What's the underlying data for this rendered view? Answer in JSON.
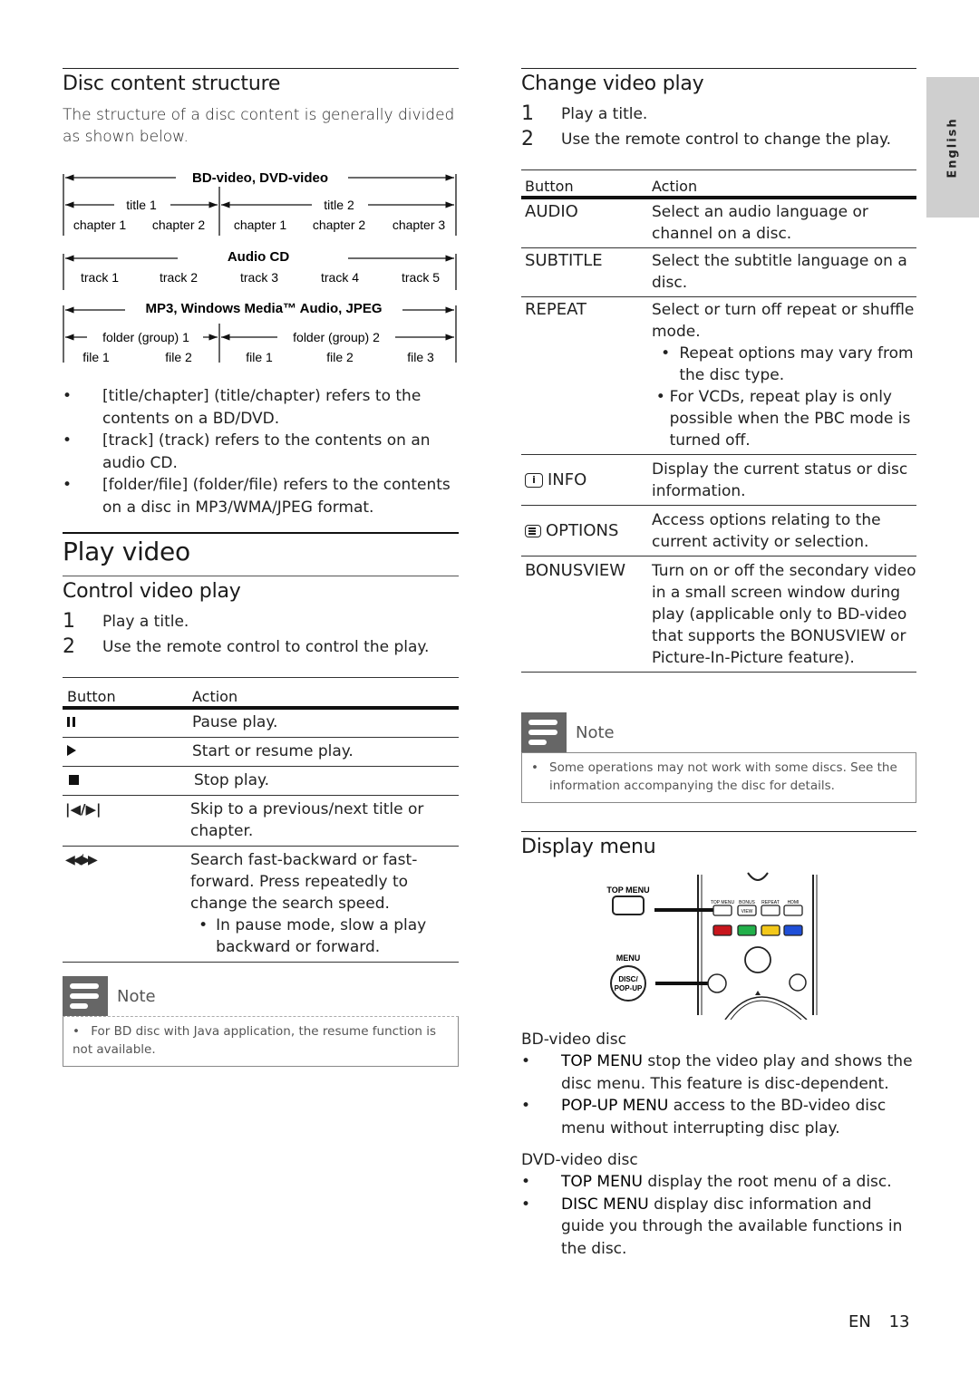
{
  "side_tab": {
    "label": "English",
    "color": "#cfcfcf"
  },
  "left": {
    "disc_structure": {
      "title": "Disc content structure",
      "intro": "The structure of a disc content is generally divided as shown below.",
      "diagram": {
        "bd": {
          "header": "BD-video, DVD-video",
          "title1": "title 1",
          "title2": "title 2",
          "chapters": [
            "chapter 1",
            "chapter 2",
            "chapter 1",
            "chapter 2",
            "chapter 3"
          ]
        },
        "cd": {
          "header": "Audio CD",
          "tracks": [
            "track 1",
            "track 2",
            "track 3",
            "track 4",
            "track 5"
          ]
        },
        "mp3": {
          "header": "MP3, Windows Media™ Audio, JPEG",
          "folder1": "folder (group) 1",
          "folder2": "folder (group) 2",
          "files": [
            "file 1",
            "file 2",
            "file 1",
            "file 2",
            "file 3"
          ]
        }
      },
      "bullets": [
        "[title/chapter] (title/chapter) refers to the contents on a BD/DVD.",
        "[track] (track) refers to the contents on an audio CD.",
        "[folder/file] (folder/file) refers to the contents on a disc in MP3/WMA/JPEG format."
      ]
    },
    "play_video": {
      "title": "Play video",
      "control": {
        "title": "Control video play",
        "steps": [
          {
            "num": "1",
            "text": "Play a title."
          },
          {
            "num": "2",
            "text": "Use the remote control to control the play."
          }
        ],
        "table": {
          "headers": [
            "Button",
            "Action"
          ],
          "rows": [
            {
              "icon": "pause-icon",
              "action": "Pause play."
            },
            {
              "icon": "play-icon",
              "action": "Start or resume play."
            },
            {
              "icon": "stop-icon",
              "action": "Stop play."
            },
            {
              "icon": "skip-icon",
              "action": "Skip to a previous/next title or chapter."
            },
            {
              "icon": "search-icon",
              "action": "Search fast-backward or fast-forward. Press repeatedly to change the search speed.",
              "sub": "In pause mode, slow a play backward or forward."
            }
          ]
        },
        "note": {
          "label": "Note",
          "text": " For BD disc with Java application, the resume function is not available."
        }
      }
    }
  },
  "right": {
    "change": {
      "title": "Change video play",
      "steps": [
        {
          "num": "1",
          "text": "Play a title."
        },
        {
          "num": "2",
          "text": "Use the remote control to change the play."
        }
      ],
      "table": {
        "headers": [
          "Button",
          "Action"
        ],
        "rows": [
          {
            "button": "AUDIO",
            "action": "Select an audio language or channel on a disc."
          },
          {
            "button": "SUBTITLE",
            "action": "Select the subtitle language on a disc."
          },
          {
            "button": "REPEAT",
            "action": "Select or turn off repeat or shuffle mode.",
            "subs": [
              "Repeat options may vary from the disc type.",
              "For VCDs, repeat play is only possible when the PBC mode is turned off."
            ]
          },
          {
            "button": "INFO",
            "icon": "info-icon",
            "action": "Display the current status or disc information."
          },
          {
            "button": "OPTIONS",
            "icon": "options-icon",
            "action": "Access options relating to the current activity or selection."
          },
          {
            "button": "BONUSVIEW",
            "action": "Turn on or off the secondary video in a small screen window during play (applicable only to BD-video that supports the BONUSVIEW or Picture-In-Picture feature)."
          }
        ]
      },
      "note": {
        "label": "Note",
        "text": "Some operations may not work with some discs. See the information accompanying the disc for details."
      }
    },
    "display_menu": {
      "title": "Display menu",
      "remote": {
        "top_menu_label": "TOP MENU",
        "menu_label": "MENU",
        "disc_popup_label": "DISC/ POP-UP",
        "small_labels": [
          "TOP MENU",
          "BONUS",
          "REPEAT",
          "HDMI"
        ],
        "view_label": "VIEW",
        "color_buttons": [
          "#c8161d",
          "#22b04a",
          "#f3c81a",
          "#1f4fd8"
        ]
      },
      "bd": {
        "title": "BD-video disc",
        "items": [
          {
            "key": "TOP MENU",
            "text": " stop the video play and shows the disc menu. This feature is disc-dependent."
          },
          {
            "key": "POP-UP MENU",
            "text": " access to the BD-video disc menu without interrupting disc play."
          }
        ]
      },
      "dvd": {
        "title": "DVD-video disc",
        "items": [
          {
            "key": "TOP MENU",
            "text": " display the root menu of a disc."
          },
          {
            "key": "DISC MENU",
            "text": " display disc information and guide you through the available functions in the disc."
          }
        ]
      }
    }
  },
  "footer": {
    "lang": "EN",
    "page": "13"
  }
}
